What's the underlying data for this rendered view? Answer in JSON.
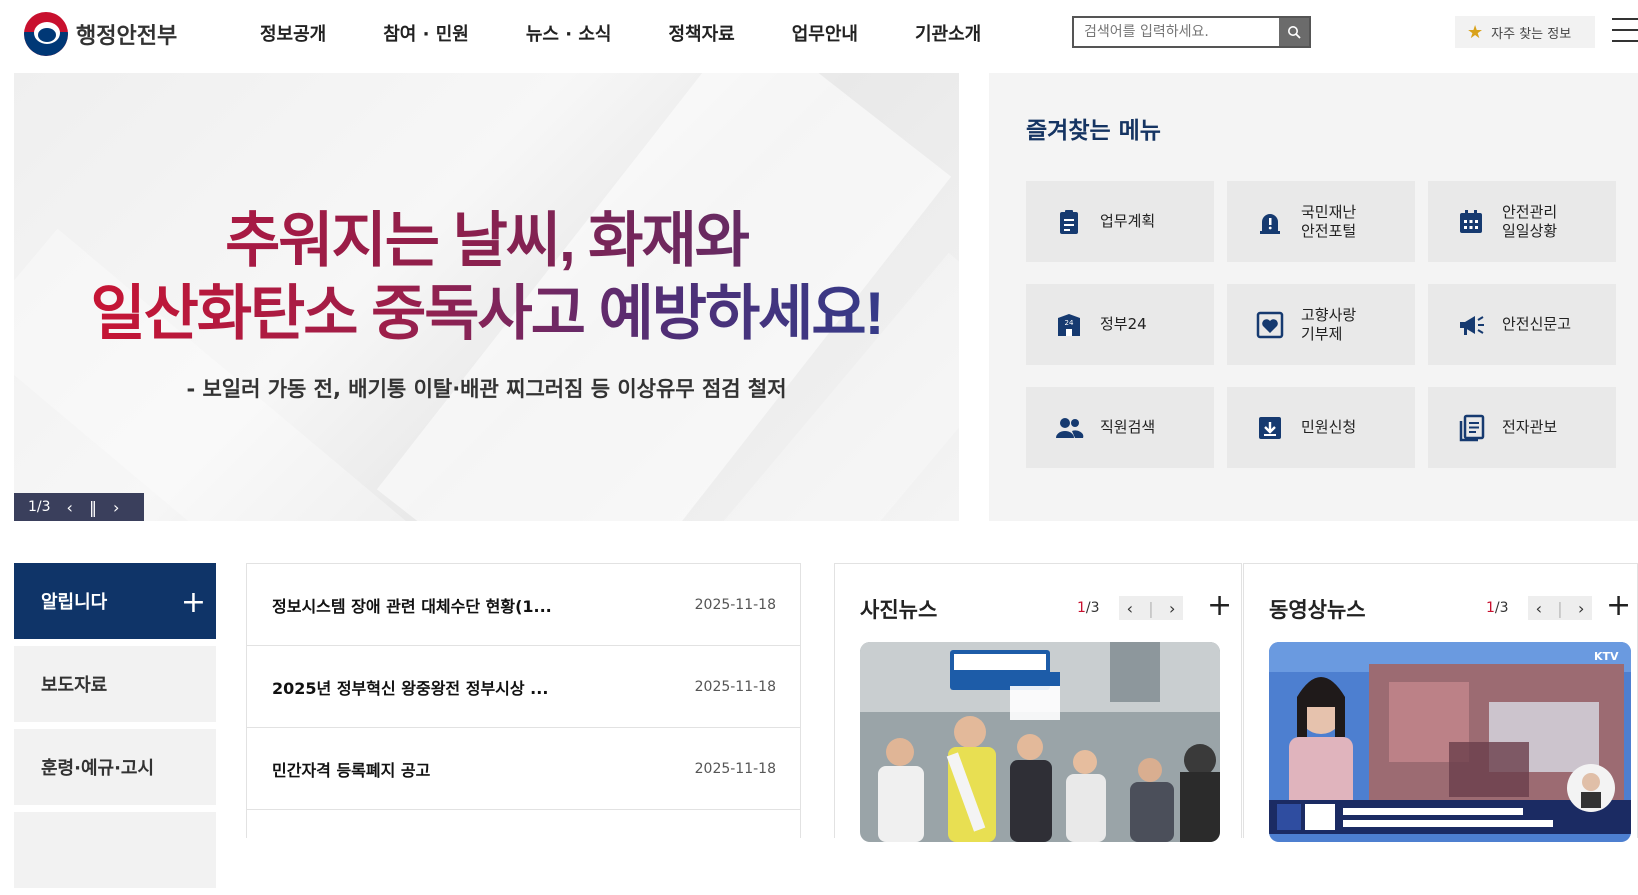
{
  "header": {
    "logo_text": "행정안전부",
    "nav": [
      "정보공개",
      "참여 · 민원",
      "뉴스 · 소식",
      "정책자료",
      "업무안내",
      "기관소개"
    ],
    "search_placeholder": "검색어를 입력하세요.",
    "favorites_label": "자주 찾는 정보"
  },
  "banner": {
    "line1": "추워지는 날씨, 화재와",
    "line2": "일산화탄소 중독사고 예방하세요!",
    "subtitle": "- 보일러 가동 전, 배기통 이탈·배관 찌그러짐 등 이상유무 점검 철저",
    "pager": "1/3"
  },
  "quick_menu": {
    "title": "즐겨찾는 메뉴",
    "items": [
      {
        "label": "업무계획",
        "icon": "clipboard-icon"
      },
      {
        "label": "국민재난\n안전포털",
        "icon": "alarm-icon"
      },
      {
        "label": "안전관리\n일일상황",
        "icon": "calendar-icon"
      },
      {
        "label": "정부24",
        "icon": "building-24-icon"
      },
      {
        "label": "고향사랑\n기부제",
        "icon": "heart-icon"
      },
      {
        "label": "안전신문고",
        "icon": "megaphone-icon"
      },
      {
        "label": "직원검색",
        "icon": "people-icon"
      },
      {
        "label": "민원신청",
        "icon": "download-box-icon"
      },
      {
        "label": "전자관보",
        "icon": "document-list-icon"
      }
    ]
  },
  "notice": {
    "tabs": [
      "알립니다",
      "보도자료",
      "훈령·예규·고시"
    ],
    "rows": [
      {
        "title": "정보시스템 장애 관련 대체수단 현황(1...",
        "date": "2025-11-18"
      },
      {
        "title": "2025년 정부혁신 왕중왕전 정부시상 ...",
        "date": "2025-11-18"
      },
      {
        "title": "민간자격 등록폐지 공고",
        "date": "2025-11-18"
      }
    ]
  },
  "photo_news": {
    "title": "사진뉴스",
    "page_current": "1",
    "page_total": "/3"
  },
  "video_news": {
    "title": "동영상뉴스",
    "page_current": "1",
    "page_total": "/3"
  },
  "colors": {
    "brand_navy": "#0f3468",
    "brand_red": "#c8102e",
    "pager_bg": "#3a3f5c"
  }
}
